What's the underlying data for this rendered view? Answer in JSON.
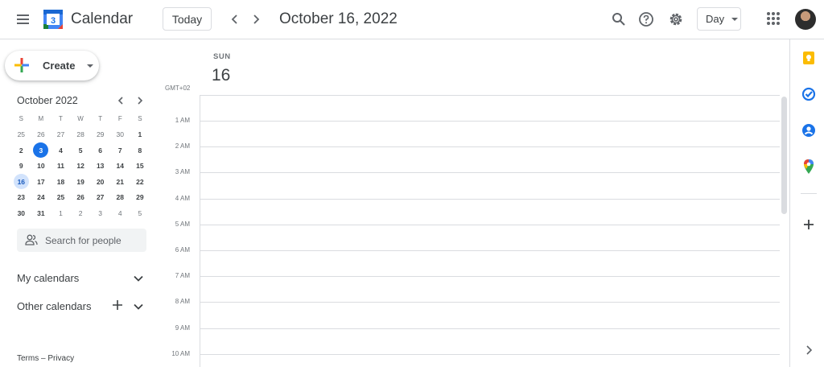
{
  "header": {
    "app_title": "Calendar",
    "logo_day": "3",
    "today_label": "Today",
    "date_title": "October 16, 2022",
    "view_label": "Day"
  },
  "sidebar": {
    "create_label": "Create",
    "mini_calendar": {
      "title": "October 2022",
      "weekdays": [
        "S",
        "M",
        "T",
        "W",
        "T",
        "F",
        "S"
      ],
      "weeks": [
        [
          "25",
          "26",
          "27",
          "28",
          "29",
          "30",
          "1"
        ],
        [
          "2",
          "3",
          "4",
          "5",
          "6",
          "7",
          "8"
        ],
        [
          "9",
          "10",
          "11",
          "12",
          "13",
          "14",
          "15"
        ],
        [
          "16",
          "17",
          "18",
          "19",
          "20",
          "21",
          "22"
        ],
        [
          "23",
          "24",
          "25",
          "26",
          "27",
          "28",
          "29"
        ],
        [
          "30",
          "31",
          "1",
          "2",
          "3",
          "4",
          "5"
        ]
      ],
      "today": "3",
      "selected": "16"
    },
    "people_search_placeholder": "Search for people",
    "my_calendars_label": "My calendars",
    "other_calendars_label": "Other calendars",
    "footer": "Terms – Privacy"
  },
  "day_view": {
    "weekday": "SUN",
    "day_number": "16",
    "timezone": "GMT+02",
    "hours": [
      "1 AM",
      "2 AM",
      "3 AM",
      "4 AM",
      "5 AM",
      "6 AM",
      "7 AM",
      "8 AM",
      "9 AM",
      "10 AM"
    ]
  },
  "side_panel": {
    "icons": [
      "keep-icon",
      "tasks-icon",
      "contacts-icon",
      "maps-icon",
      "add-icon",
      "expand-panel-icon"
    ]
  },
  "colors": {
    "accent": "#1a73e8",
    "selected_bg": "#d2e3fc",
    "divider": "#dadce0"
  }
}
